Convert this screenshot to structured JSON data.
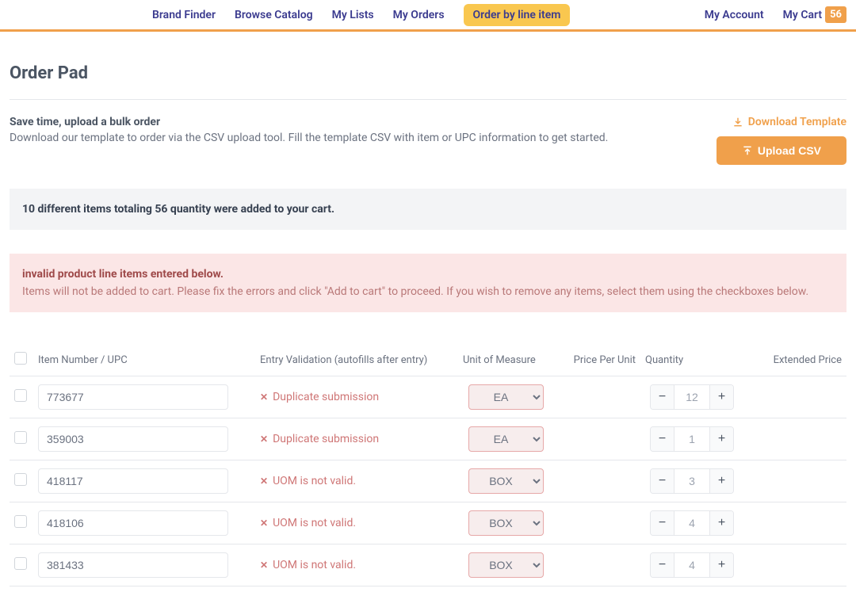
{
  "nav": {
    "items": [
      {
        "label": "Brand Finder",
        "active": false
      },
      {
        "label": "Browse Catalog",
        "active": false
      },
      {
        "label": "My Lists",
        "active": false
      },
      {
        "label": "My Orders",
        "active": false
      },
      {
        "label": "Order by line item",
        "active": true
      }
    ],
    "myAccount": "My Account",
    "myCart": "My Cart",
    "cartCount": "56"
  },
  "page": {
    "title": "Order Pad"
  },
  "bulk": {
    "title": "Save time, upload a bulk order",
    "desc": "Download our template to order via the CSV upload tool. Fill the template CSV with item or UPC information to get started.",
    "download": "Download Template",
    "upload": "Upload CSV"
  },
  "successAlert": "10 different items totaling 56 quantity were added to your cart.",
  "errorAlert": {
    "title": "invalid product line items entered below.",
    "body": "Items will not be added to cart. Please fix the errors and click \"Add to cart\" to proceed. If you wish to remove any items, select them using the checkboxes below."
  },
  "table": {
    "headers": {
      "item": "Item Number / UPC",
      "validation": "Entry Validation (autofills after entry)",
      "uom": "Unit of Measure",
      "ppu": "Price Per Unit",
      "qty": "Quantity",
      "ext": "Extended Price"
    },
    "rows": [
      {
        "item": "773677",
        "validation": "Duplicate submission",
        "uom": "EA",
        "qty": "12"
      },
      {
        "item": "359003",
        "validation": "Duplicate submission",
        "uom": "EA",
        "qty": "1"
      },
      {
        "item": "418117",
        "validation": "UOM is not valid.",
        "uom": "BOX",
        "qty": "3"
      },
      {
        "item": "418106",
        "validation": "UOM is not valid.",
        "uom": "BOX",
        "qty": "4"
      },
      {
        "item": "381433",
        "validation": "UOM is not valid.",
        "uom": "BOX",
        "qty": "4"
      }
    ]
  }
}
